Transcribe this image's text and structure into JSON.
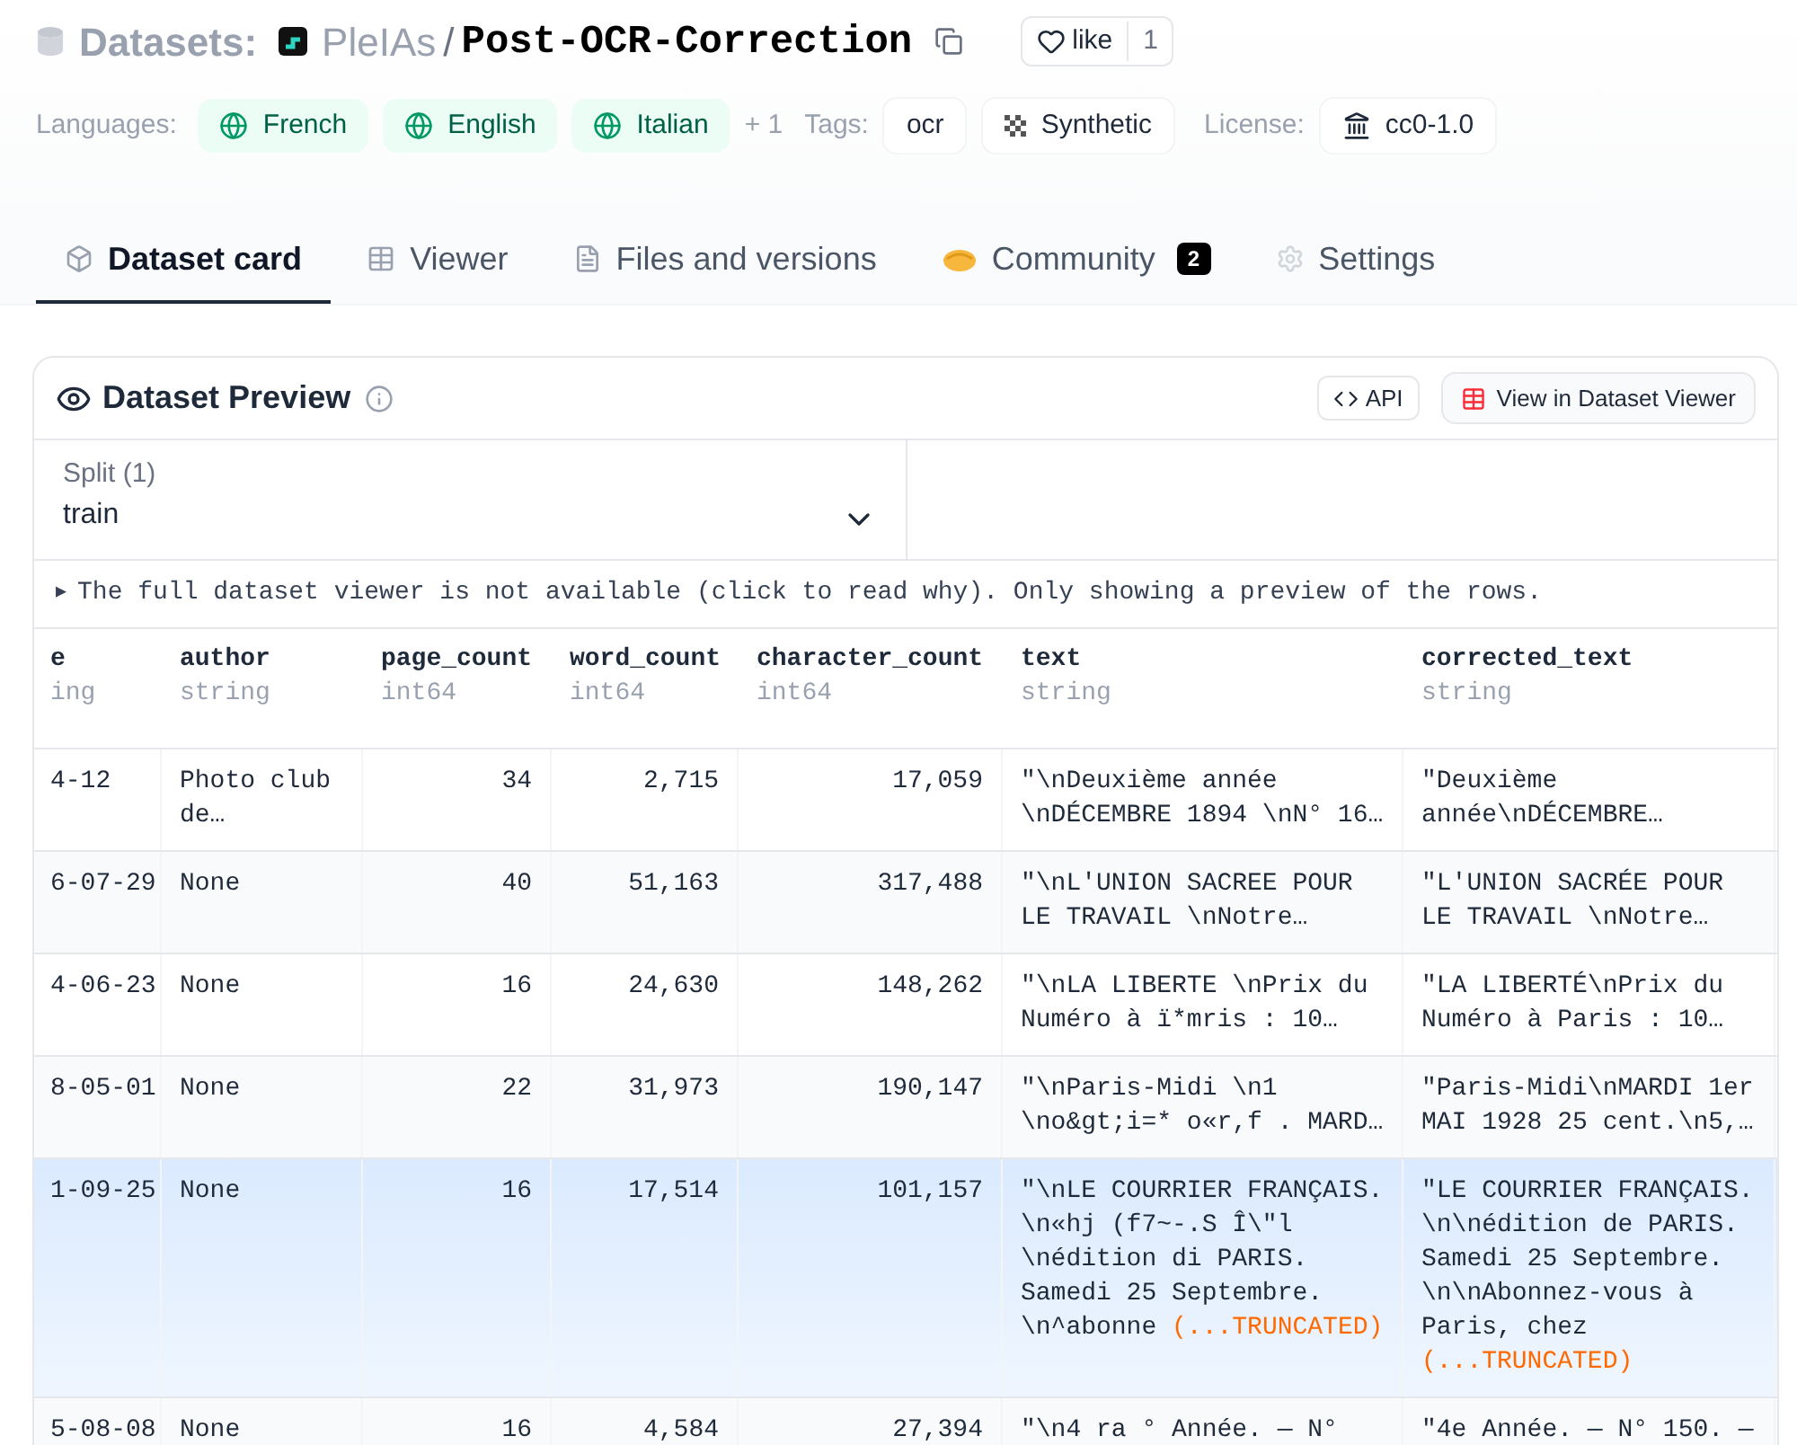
{
  "breadcrumb": {
    "section": "Datasets:",
    "owner": "PleIAs",
    "separator": "/",
    "name": "Post-OCR-Correction"
  },
  "like": {
    "label": "like",
    "count": "1"
  },
  "meta": {
    "languages_label": "Languages:",
    "languages": [
      "French",
      "English",
      "Italian"
    ],
    "languages_more": "+ 1",
    "tags_label": "Tags:",
    "tags": [
      {
        "label": "ocr",
        "kind": "plain"
      },
      {
        "label": "Synthetic",
        "kind": "checker"
      }
    ],
    "license_label": "License:",
    "license": "cc0-1.0"
  },
  "tabs": [
    {
      "label": "Dataset card",
      "selected": true
    },
    {
      "label": "Viewer",
      "selected": false
    },
    {
      "label": "Files and versions",
      "selected": false
    },
    {
      "label": "Community",
      "badge": "2",
      "selected": false
    },
    {
      "label": "Settings",
      "selected": false
    }
  ],
  "preview": {
    "title": "Dataset Preview",
    "api_label": "API",
    "viewer_label": "View in Dataset Viewer",
    "split_label": "Split (1)",
    "split_value": "train",
    "notice_marker": "▶",
    "notice": "The full dataset viewer is not available (click to read why). Only showing a preview of the rows."
  },
  "table": {
    "columns": [
      {
        "name": "e",
        "type": "ing"
      },
      {
        "name": "author",
        "type": "string"
      },
      {
        "name": "page_count",
        "type": "int64"
      },
      {
        "name": "word_count",
        "type": "int64"
      },
      {
        "name": "character_count",
        "type": "int64"
      },
      {
        "name": "text",
        "type": "string"
      },
      {
        "name": "corrected_text",
        "type": "string"
      }
    ],
    "rows": [
      {
        "selected": false,
        "cells": [
          {
            "text": "4-12"
          },
          {
            "text": "Photo club de…"
          },
          {
            "text": "34"
          },
          {
            "text": "2,715"
          },
          {
            "text": "17,059"
          },
          {
            "text": "\"\\nDeuxième année \\nDÉCEMBRE 1894 \\nN° 16…"
          },
          {
            "text": "\"Deuxième année\\nDÉCEMBRE…"
          }
        ]
      },
      {
        "selected": false,
        "cells": [
          {
            "text": "6-07-29"
          },
          {
            "text": "None"
          },
          {
            "text": "40"
          },
          {
            "text": "51,163"
          },
          {
            "text": "317,488"
          },
          {
            "text": "\"\\nL'UNION SACREE POUR LE TRAVAIL \\nNotre…"
          },
          {
            "text": "\"L'UNION SACRÉE POUR LE TRAVAIL \\nNotre…"
          }
        ]
      },
      {
        "selected": false,
        "cells": [
          {
            "text": "4-06-23"
          },
          {
            "text": "None"
          },
          {
            "text": "16"
          },
          {
            "text": "24,630"
          },
          {
            "text": "148,262"
          },
          {
            "text": "\"\\nLA LIBERTE \\nPrix du Numéro à ï*mris : 10…"
          },
          {
            "text": "\"LA LIBERTÉ\\nPrix du Numéro à Paris : 10…"
          }
        ]
      },
      {
        "selected": false,
        "cells": [
          {
            "text": "8-05-01"
          },
          {
            "text": "None"
          },
          {
            "text": "22"
          },
          {
            "text": "31,973"
          },
          {
            "text": "190,147"
          },
          {
            "text": "\"\\nParis-Midi \\n1 \\no&gt;i=* o«r,f . MARD…"
          },
          {
            "text": "\"Paris-Midi\\nMARDI 1er MAI 1928 25 cent.\\n5,…"
          }
        ]
      },
      {
        "selected": true,
        "cells": [
          {
            "text": "1-09-25"
          },
          {
            "text": "None"
          },
          {
            "text": "16"
          },
          {
            "text": "17,514"
          },
          {
            "text": "101,157"
          },
          {
            "text": "\"\\nLE COURRIER FRANÇAIS. \\n«hj (f7~-.S Î\\\"l \\nédition di PARIS. Samedi 25 Septembre. \\n^abonne",
            "note": "(...TRUNCATED)"
          },
          {
            "text": "\"LE COURRIER FRANÇAIS. \\n\\nédition de PARIS. Samedi 25 Septembre. \\n\\nAbonnez-vous à Paris, chez",
            "note": "(...TRUNCATED)"
          }
        ]
      },
      {
        "selected": false,
        "cells": [
          {
            "text": "5-08-08"
          },
          {
            "text": "None"
          },
          {
            "text": "16"
          },
          {
            "text": "4,584"
          },
          {
            "text": "27,394"
          },
          {
            "text": "\"\\n4 ra ° Année. — N°"
          },
          {
            "text": "\"4e Année. — N° 150. —"
          }
        ]
      }
    ]
  }
}
